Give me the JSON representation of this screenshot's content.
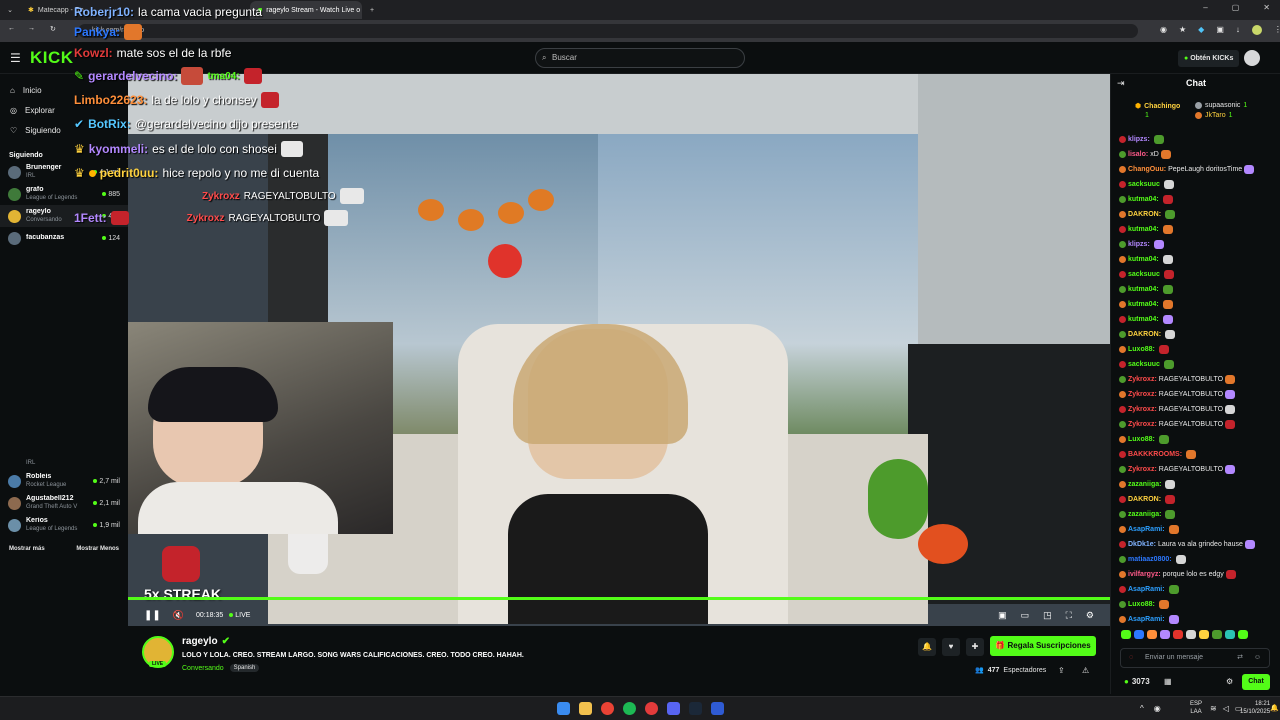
{
  "browser": {
    "tabs": [
      "Matecapp - Ra",
      "rageylo Stream - Watch Live o"
    ],
    "url": "kick.com/rageylo"
  },
  "header": {
    "logo": "KICK",
    "search_placeholder": "Buscar",
    "get_kicks": "Obtén KICKs"
  },
  "sidebar": {
    "nav": [
      "Inicio",
      "Explorar",
      "Siguiendo"
    ],
    "section": "Siguiendo",
    "channels": [
      {
        "name": "Brunenger",
        "category": "IRL",
        "viewers": "4,1 mil"
      },
      {
        "name": "grafo",
        "category": "League of Legends",
        "viewers": "885"
      },
      {
        "name": "rageylo",
        "category": "Conversando",
        "viewers": "477"
      },
      {
        "name": "facubanzas",
        "category": "",
        "viewers": "124"
      }
    ],
    "channels_lower": [
      {
        "name": "Robleis",
        "category": "Rocket League",
        "viewers": "2,7 mil"
      },
      {
        "name": "Agustabell212",
        "category": "Grand Theft Auto V",
        "viewers": "2,1 mil"
      },
      {
        "name": "Kerios",
        "category": "League of Legends",
        "viewers": "1,9 mil"
      }
    ],
    "irl_tag": "IRL",
    "show_more": "Mostrar más",
    "show_less": "Mostrar Menos"
  },
  "overlay_chat": [
    {
      "user": "Roberjr10:",
      "msg": "la cama vacia pregunta",
      "color": "#7fb2ff"
    },
    {
      "user": "Pankya:",
      "msg": "",
      "color": "#2c78ff"
    },
    {
      "user": "Kowzl:",
      "msg": "mate sos el de la rbfe",
      "color": "#e23b3b"
    },
    {
      "user": "gerardelvecino:",
      "msg": "",
      "color": "#b388ff"
    },
    {
      "user": "Limbo22623:",
      "msg": "la de lolo y chonsey",
      "color": "#ff8f3a"
    },
    {
      "user": "BotRix:",
      "msg": "@gerardelvecino dijo presente",
      "color": "#55c7ff"
    },
    {
      "user": "kyommeli:",
      "msg": "es el de lolo con shosei",
      "color": "#b388ff"
    },
    {
      "user": "pedrit0uu:",
      "msg": "hice repolo y no me di cuenta",
      "color": "#ffd23f"
    },
    {
      "user": "Zykroxz",
      "msg": "RAGEYALTOBULTO",
      "color": "#ff4b4b"
    },
    {
      "user": "1Fett:",
      "msg": "",
      "color": "#b388ff"
    },
    {
      "user": "Zykroxz",
      "msg": "RAGEYALTOBULTO",
      "color": "#ff4b4b"
    }
  ],
  "overlay_mini": [
    {
      "user": "tma04:",
      "color": "#53fc18"
    }
  ],
  "player": {
    "streak": "5x STREAK",
    "time": "00:18:35",
    "live": "LIVE"
  },
  "stream_info": {
    "channel": "rageylo",
    "title": "LOLO Y LOLA. CREO. STREAM LARGO. SONG WARS CALIFICACIONES. CREO. TODO CREO. HAHAH.",
    "category": "Conversando",
    "language": "Spanish",
    "live_badge": "LIVE",
    "subs_button": "Regala Suscripciones",
    "viewers": "477",
    "viewers_label": "Espectadores"
  },
  "chat": {
    "title": "Chat",
    "top_gifters": [
      {
        "name": "Chachingo",
        "count": "1"
      },
      {
        "name": "supaasonic",
        "count": "1"
      },
      {
        "name": "JkTaro",
        "count": "1"
      }
    ],
    "messages": [
      {
        "user": "klipzs:",
        "msg": "",
        "color": "#b388ff"
      },
      {
        "user": "lisalo:",
        "msg": "xD",
        "color": "#ff5a8a"
      },
      {
        "user": "ChangOuu:",
        "msg": "PepeLaugh doritosTime",
        "color": "#ff8f3a"
      },
      {
        "user": "sacksuuc",
        "msg": "",
        "color": "#53fc18"
      },
      {
        "user": "kutma04:",
        "msg": "",
        "color": "#53fc18"
      },
      {
        "user": "DAKRON:",
        "msg": "",
        "color": "#ffd23f"
      },
      {
        "user": "kutma04:",
        "msg": "",
        "color": "#53fc18"
      },
      {
        "user": "klipzs:",
        "msg": "",
        "color": "#b388ff"
      },
      {
        "user": "kutma04:",
        "msg": "",
        "color": "#53fc18"
      },
      {
        "user": "sacksuuc",
        "msg": "",
        "color": "#53fc18"
      },
      {
        "user": "kutma04:",
        "msg": "",
        "color": "#53fc18"
      },
      {
        "user": "kutma04:",
        "msg": "",
        "color": "#53fc18"
      },
      {
        "user": "kutma04:",
        "msg": "",
        "color": "#53fc18"
      },
      {
        "user": "DAKRON:",
        "msg": "",
        "color": "#ffd23f"
      },
      {
        "user": "Luxo88:",
        "msg": "",
        "color": "#53fc18"
      },
      {
        "user": "sacksuuc",
        "msg": "",
        "color": "#53fc18"
      },
      {
        "user": "Zykroxz:",
        "msg": "RAGEYALTOBULTO",
        "color": "#ff4b4b"
      },
      {
        "user": "Zykroxz:",
        "msg": "RAGEYALTOBULTO",
        "color": "#ff4b4b"
      },
      {
        "user": "Zykroxz:",
        "msg": "RAGEYALTOBULTO",
        "color": "#ff4b4b"
      },
      {
        "user": "Zykroxz:",
        "msg": "RAGEYALTOBULTO",
        "color": "#ff4b4b"
      },
      {
        "user": "Luxo88:",
        "msg": "",
        "color": "#53fc18"
      },
      {
        "user": "BAKKKROOMS:",
        "msg": "",
        "color": "#ff4b4b"
      },
      {
        "user": "Zykroxz:",
        "msg": "RAGEYALTOBULTO",
        "color": "#ff4b4b"
      },
      {
        "user": "zazaniiga:",
        "msg": "",
        "color": "#53fc18"
      },
      {
        "user": "DAKRON:",
        "msg": "",
        "color": "#ffd23f"
      },
      {
        "user": "zazaniiga:",
        "msg": "",
        "color": "#53fc18"
      },
      {
        "user": "AsapRami:",
        "msg": "",
        "color": "#2c9fff"
      },
      {
        "user": "DkDk1e:",
        "msg": "Laura va ala grindeo hause",
        "color": "#7fb2ff"
      },
      {
        "user": "matiaaz0800:",
        "msg": "",
        "color": "#2c78ff"
      },
      {
        "user": "ivilfargyz:",
        "msg": "porque lolo es edgy",
        "color": "#ff5a8a"
      },
      {
        "user": "AsapRami:",
        "msg": "",
        "color": "#2c9fff"
      },
      {
        "user": "Luxo88:",
        "msg": "",
        "color": "#53fc18"
      },
      {
        "user": "AsapRami:",
        "msg": "",
        "color": "#2c9fff"
      }
    ],
    "send_placeholder": "Enviar un mensaje",
    "kicks_count": "3073",
    "chat_button": "Chat"
  },
  "taskbar": {
    "lang": "ESP",
    "lang2": "LAA",
    "time": "18:21",
    "date": "15/10/2025"
  }
}
